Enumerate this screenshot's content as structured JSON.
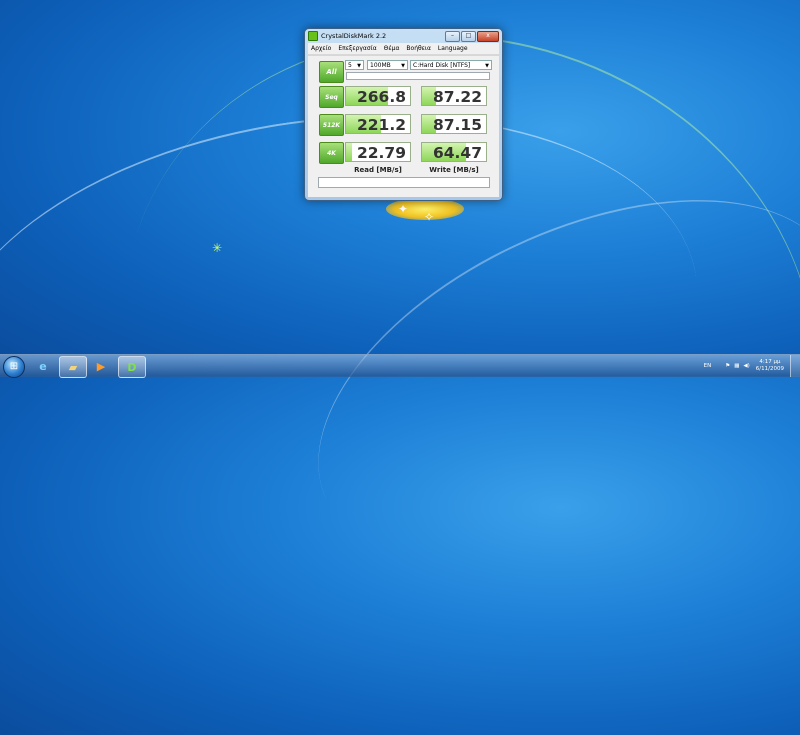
{
  "window": {
    "title": "CrystalDiskMark 2.2",
    "controls": {
      "minimize": "–",
      "maximize": "□",
      "close": "x"
    },
    "menu": [
      "Αρχείο",
      "Επεξεργασία",
      "Θέμα",
      "Βοήθεια",
      "Language"
    ]
  },
  "settings": {
    "all_label": "All",
    "passes": "5",
    "size": "100MB",
    "drive": "C:Hard Disk [NTFS]"
  },
  "results": [
    {
      "label": "Seq",
      "read": "266.8",
      "write": "87.22",
      "read_fill": 0.65,
      "write_fill": 0.22
    },
    {
      "label": "512K",
      "read": "221.2",
      "write": "87.15",
      "read_fill": 0.55,
      "write_fill": 0.22
    },
    {
      "label": "4K",
      "read": "22.79",
      "write": "64.47",
      "read_fill": 0.1,
      "write_fill": 0.68
    }
  ],
  "columns": {
    "read": "Read [MB/s]",
    "write": "Write [MB/s]"
  },
  "taskbar": {
    "apps": [
      "start-orb",
      "internet-explorer-icon",
      "windows-explorer-icon",
      "media-player-icon",
      "crystaldiskmark-icon"
    ],
    "language": "EN",
    "time": "4:17 μμ",
    "date": "6/11/2009"
  },
  "colors": {
    "accent_green": "#4fa82a",
    "bar_fill": "#8ed65a"
  }
}
